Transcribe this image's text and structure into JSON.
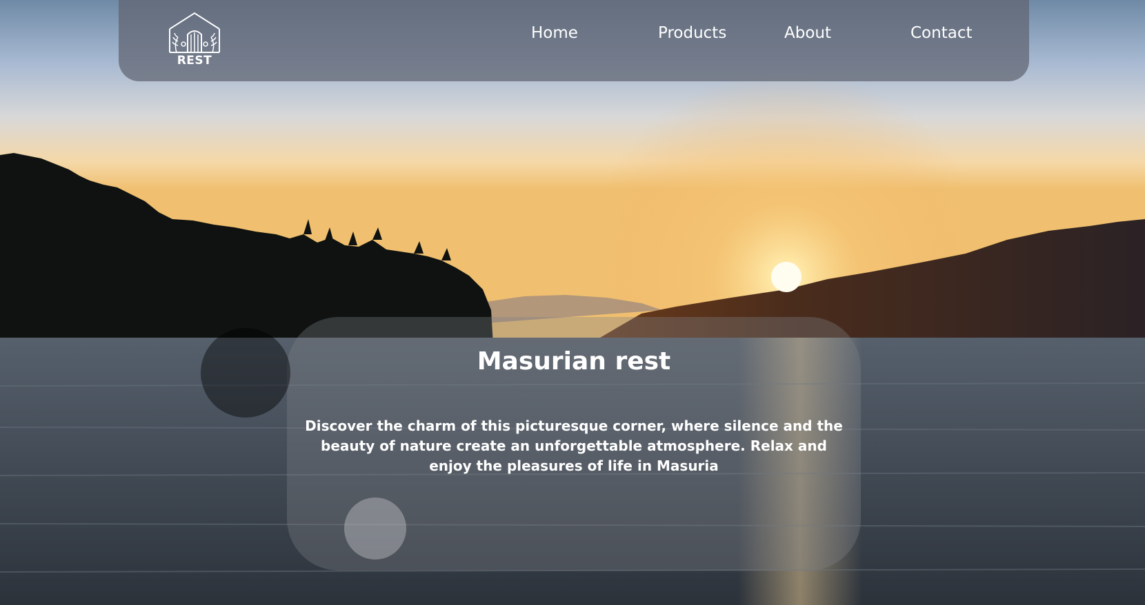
{
  "nav": {
    "logo_text": "REST",
    "links": [
      "Home",
      "Products",
      "About",
      "Contact"
    ]
  },
  "hero": {
    "title": "Masurian rest",
    "description": "Discover the charm of this picturesque corner, where silence and the beauty of nature create an unforgettable atmosphere. Relax and enjoy the pleasures of life in Masuria"
  },
  "background": {
    "icon": "lake-sunset-photo",
    "sky_top": "#7f9bb8",
    "sky_mid": "#b9c8dc",
    "glow": "#f7dca8",
    "water": "#3e4752"
  },
  "colors": {
    "nav_bg": "#5f6470",
    "text": "#ffffff"
  }
}
